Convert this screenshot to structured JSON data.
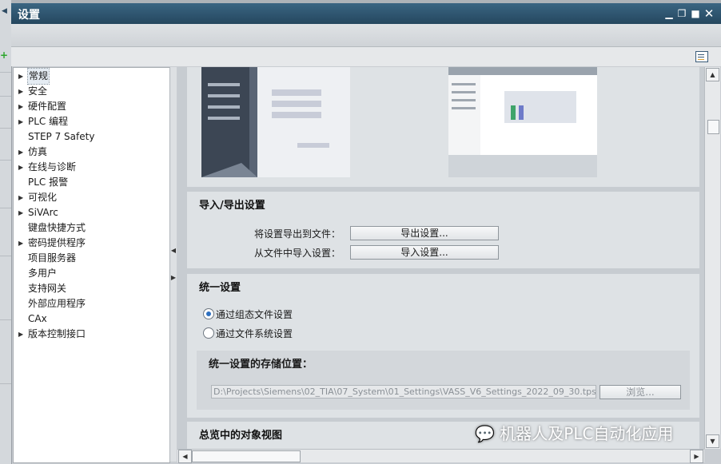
{
  "window": {
    "title": "设置"
  },
  "nav": {
    "items": [
      {
        "label": "常规",
        "expandable": true,
        "selected": true
      },
      {
        "label": "安全",
        "expandable": true
      },
      {
        "label": "硬件配置",
        "expandable": true
      },
      {
        "label": "PLC 编程",
        "expandable": true
      },
      {
        "label": "STEP 7 Safety",
        "expandable": false
      },
      {
        "label": "仿真",
        "expandable": true
      },
      {
        "label": "在线与诊断",
        "expandable": true
      },
      {
        "label": "PLC 报警",
        "expandable": false
      },
      {
        "label": "可视化",
        "expandable": true
      },
      {
        "label": "SiVArc",
        "expandable": true
      },
      {
        "label": "键盘快捷方式",
        "expandable": false
      },
      {
        "label": "密码提供程序",
        "expandable": true
      },
      {
        "label": "项目服务器",
        "expandable": false
      },
      {
        "label": "多用户",
        "expandable": false
      },
      {
        "label": "支持网关",
        "expandable": false
      },
      {
        "label": "外部应用程序",
        "expandable": false
      },
      {
        "label": "CAx",
        "expandable": false
      },
      {
        "label": "版本控制接口",
        "expandable": true
      }
    ]
  },
  "import_export": {
    "title": "导入/导出设置",
    "export_label": "将设置导出到文件：",
    "export_button": "导出设置...",
    "import_label": "从文件中导入设置：",
    "import_button": "导入设置..."
  },
  "unified": {
    "title": "统一设置",
    "option1": "通过组态文件设置",
    "option2": "通过文件系统设置",
    "selected": "option1",
    "storage_title": "统一设置的存储位置：",
    "path_value": "D:\\Projects\\Siemens\\02_TIA\\07_System\\01_Settings\\VASS_V6_Settings_2022_09_30.tps",
    "browse_button": "浏览..."
  },
  "overview": {
    "title": "总览中的对象视图"
  },
  "watermark": {
    "text": "机器人及PLC自动化应用"
  }
}
